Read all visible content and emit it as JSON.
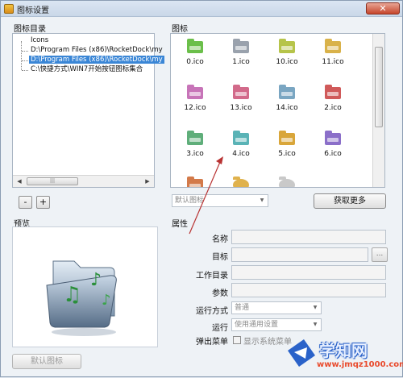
{
  "window": {
    "title": "图标设置",
    "close_glyph": "✕"
  },
  "left": {
    "group_label": "图标目录",
    "tree": [
      {
        "label": "Icons",
        "selected": false
      },
      {
        "label": "D:\\Program Files (x86)\\RocketDock\\my",
        "selected": false
      },
      {
        "label": "D:\\Program Files (x86)\\RocketDock\\my",
        "selected": true
      },
      {
        "label": "C:\\快捷方式\\WIN7开始按钮图标集合",
        "selected": false
      }
    ],
    "minus_label": "-",
    "plus_label": "+",
    "scroll_left": "◀",
    "scroll_right": "▶",
    "scroll_grip": "|||"
  },
  "icons": {
    "group_label": "图标",
    "items": [
      {
        "label": "0.ico",
        "color": "#6bbf4a"
      },
      {
        "label": "1.ico",
        "color": "#9aa2ad"
      },
      {
        "label": "10.ico",
        "color": "#b6c44a"
      },
      {
        "label": "11.ico",
        "color": "#d9b24a"
      },
      {
        "label": "12.ico",
        "color": "#c774b8"
      },
      {
        "label": "13.ico",
        "color": "#d26a8a"
      },
      {
        "label": "14.ico",
        "color": "#7aa6c2"
      },
      {
        "label": "2.ico",
        "color": "#d05a5a"
      },
      {
        "label": "3.ico",
        "color": "#5fae7a"
      },
      {
        "label": "4.ico",
        "color": "#5ab3b6"
      },
      {
        "label": "5.ico",
        "color": "#d9a63a"
      },
      {
        "label": "6.ico",
        "color": "#8b6fc9"
      },
      {
        "label": "",
        "color": "#d37a4a"
      },
      {
        "label": "",
        "color": "#e0b24d"
      },
      {
        "label": "",
        "color": "#c9c9c9"
      }
    ],
    "filter_select": "默认图标",
    "get_more_button": "获取更多"
  },
  "preview": {
    "group_label": "预览",
    "default_icon_button": "默认图标"
  },
  "properties": {
    "group_label": "属性",
    "name_label": "名称",
    "target_label": "目标",
    "browse_label": "...",
    "workdir_label": "工作目录",
    "args_label": "参数",
    "run_mode_label": "运行方式",
    "run_mode_value": "普通",
    "run_label": "运行",
    "run_value": "使用通用设置",
    "popup_label": "弹出菜单",
    "popup_checkbox_label": "显示系统菜单"
  },
  "watermark": {
    "text": "学知网",
    "url": "www.jmqz1000.com"
  }
}
